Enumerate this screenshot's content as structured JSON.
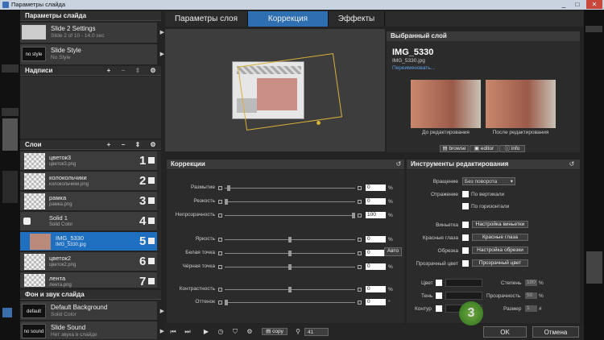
{
  "window": {
    "title": "Параметры слайда",
    "minimize": "_",
    "restore": "□",
    "close": "✕"
  },
  "left": {
    "header": "Параметры слайда",
    "slides": [
      {
        "name": "Slide 2 Settings",
        "sub": "Slide 2 of 10 - 14.0 sec"
      },
      {
        "badge": "no style",
        "name": "Slide Style",
        "sub": "No Style"
      }
    ],
    "captions_header": "Надписи",
    "layers_header": "Слои",
    "layers": [
      {
        "name": "цветок3",
        "file": "цветок3.png",
        "num": "1"
      },
      {
        "name": "колокольчики",
        "file": "колокольчики.png",
        "num": "2"
      },
      {
        "name": "рамка",
        "file": "рамка.png",
        "num": "3"
      },
      {
        "name": "Solid 1",
        "file": "Solid Color",
        "num": "4"
      },
      {
        "name": "IMG_5330",
        "file": "IMG_5330.jpg",
        "num": "5"
      },
      {
        "name": "цветок2",
        "file": "цветок2.png",
        "num": "6"
      },
      {
        "name": "лента",
        "file": "лента.png",
        "num": "7"
      }
    ],
    "bg_header": "Фон и звук слайда",
    "bg_items": [
      {
        "badge": "default",
        "name": "Default Background",
        "sub": "Solid Color"
      },
      {
        "badge": "no sound",
        "name": "Slide Sound",
        "sub": "Нет звука в слайде"
      }
    ]
  },
  "tabs": [
    "Параметры слоя",
    "Коррекция",
    "Эффекты"
  ],
  "selected_layer": {
    "header": "Выбранный слой",
    "name": "IMG_5330",
    "file": "IMG_5330.jpg",
    "rename": "Переименовать...",
    "before": "До редактирования",
    "after": "После редактирования",
    "browse": "browse",
    "editor": "editor",
    "info": "info"
  },
  "corrections": {
    "header": "Коррекции",
    "rows": [
      {
        "label": "Размытие",
        "value": "0",
        "unit": "%",
        "pos": 0.02
      },
      {
        "label": "Резкость",
        "value": "0",
        "unit": "%",
        "pos": 0.0
      },
      {
        "label": "Непрозрачность",
        "value": "100",
        "unit": "%",
        "pos": 1.0
      },
      {
        "label": "Яркость",
        "value": "0",
        "unit": "%",
        "pos": 0.5
      },
      {
        "label": "Белая точка",
        "value": "0",
        "unit": "%",
        "pos": 0.5
      },
      {
        "label": "Чёрная точка",
        "value": "0",
        "unit": "%",
        "pos": 0.5
      },
      {
        "label": "Контрастность",
        "value": "0",
        "unit": "%",
        "pos": 0.5
      },
      {
        "label": "Оттенок",
        "value": "0",
        "unit": "°",
        "pos": 0.0
      }
    ],
    "auto": "Авто"
  },
  "tools": {
    "header": "Инструменты редактирования",
    "rotation_label": "Вращение",
    "rotation_value": "Без поворота",
    "mirror_label": "Отражение",
    "vertical": "По вертикали",
    "horizontal": "По горизонтали",
    "vignette": "Виньетка",
    "vignette_btn": "Настройка виньетки",
    "redeye": "Красные глаза",
    "redeye_btn": "Красные глаза",
    "crop": "Обрезка",
    "crop_btn": "Настройка обрезки",
    "transp": "Прозрачный цвет",
    "transp_btn": "Прозрачный цвет",
    "color": "Цвет",
    "degree": "Степень",
    "degree_val": "100",
    "shadow": "Тень",
    "opacity": "Прозрачность",
    "opacity_val": "50",
    "outline": "Контур",
    "size": "Размер",
    "size_val": "1",
    "pct": "%",
    "hash": "#"
  },
  "bottom": {
    "copy": "copy",
    "zoom": "41",
    "ok": "OK",
    "cancel": "Отмена"
  },
  "watermark": "3"
}
